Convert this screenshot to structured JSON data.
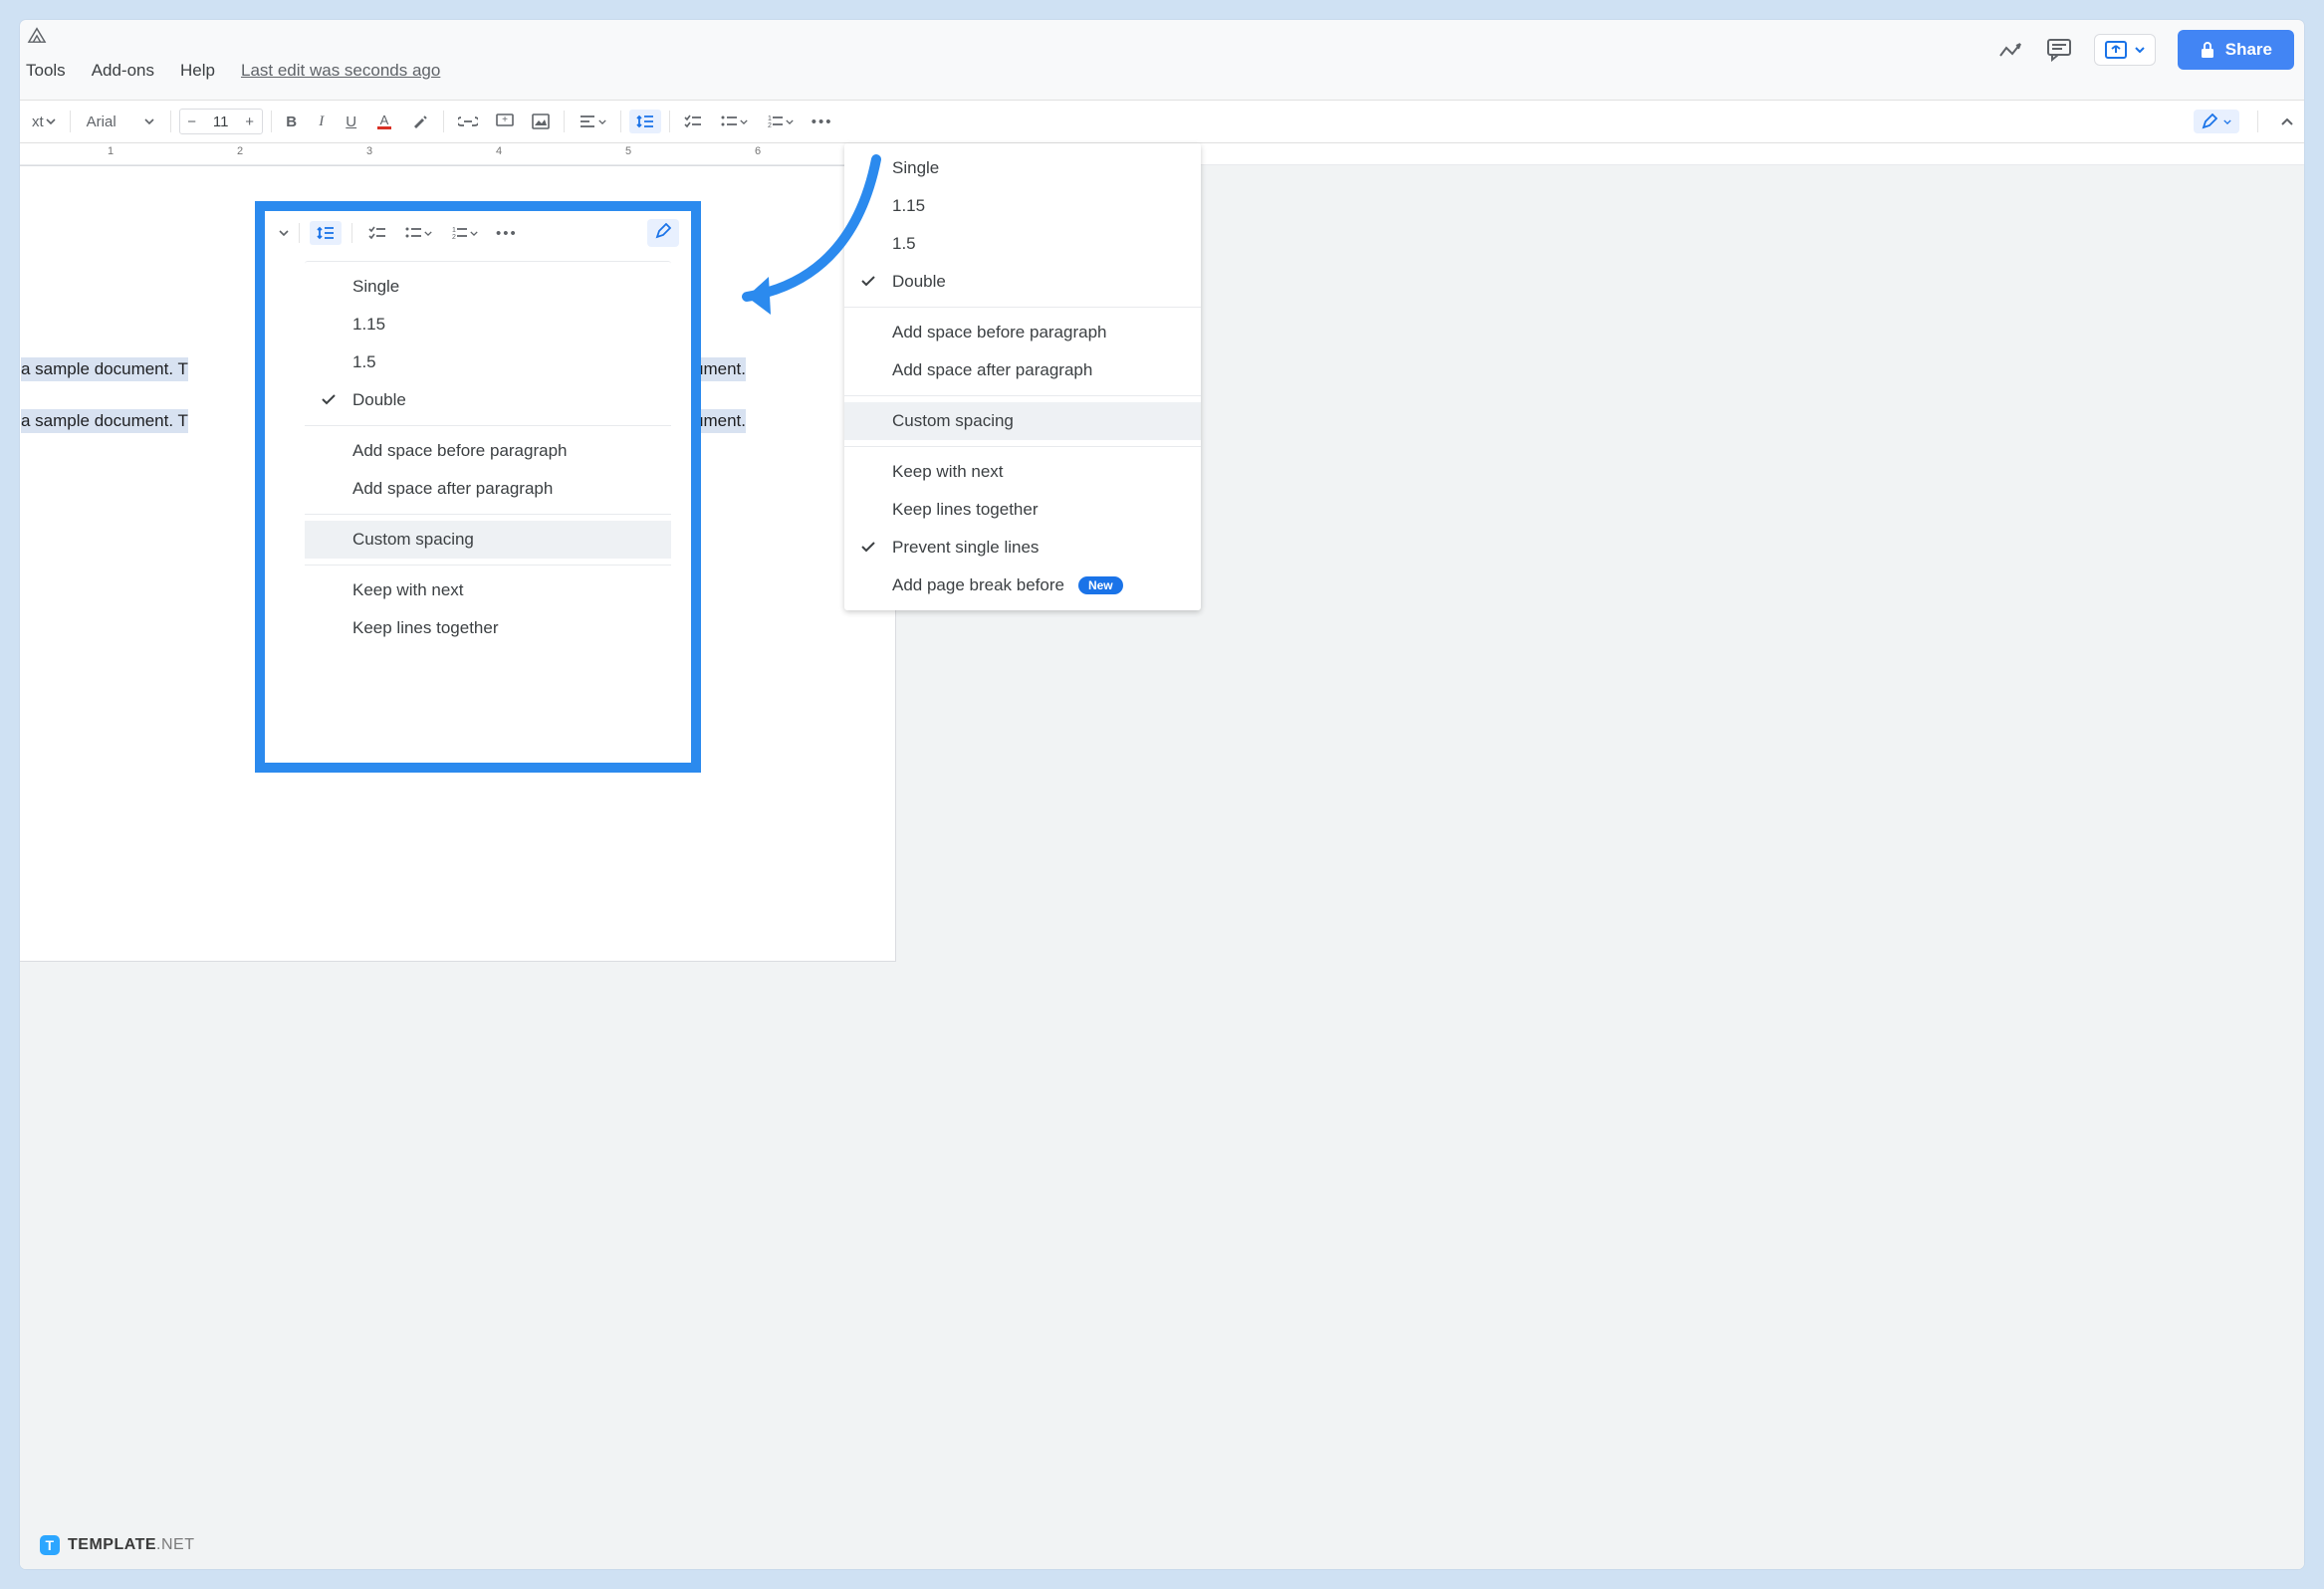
{
  "topbar": {
    "menu": {
      "tools": "Tools",
      "addons": "Add-ons",
      "help": "Help"
    },
    "last_edit": "Last edit was seconds ago",
    "share": "Share"
  },
  "toolbar": {
    "text_style": "xt",
    "font": "Arial",
    "font_size": "11"
  },
  "ruler": {
    "numbers": [
      "1",
      "2",
      "3",
      "4",
      "5",
      "6"
    ]
  },
  "document": {
    "line1": "a sample document. T",
    "line1b": "ument.",
    "line2": "a sample document. T",
    "line2b": "ument."
  },
  "line_spacing_menu": {
    "single": "Single",
    "v115": "1.15",
    "v15": "1.5",
    "double": "Double",
    "add_before": "Add space before paragraph",
    "add_after": "Add space after paragraph",
    "custom": "Custom spacing",
    "keep_next": "Keep with next",
    "keep_lines": "Keep lines together",
    "prevent_single": "Prevent single lines",
    "page_break": "Add page break before",
    "badge_new": "New"
  },
  "watermark": {
    "brand": "TEMPLATE",
    "suffix": ".NET"
  }
}
